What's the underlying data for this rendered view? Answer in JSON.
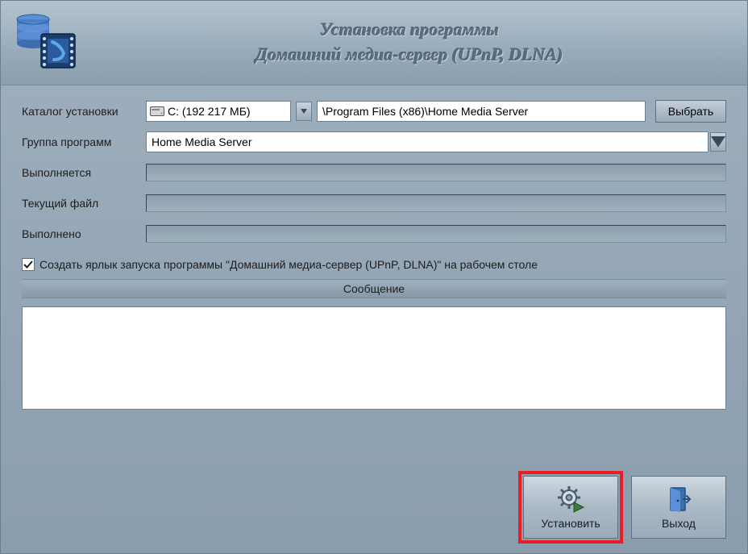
{
  "header": {
    "title_line1": "Установка программы",
    "title_line2": "Домашний медиа-сервер (UPnP, DLNA)"
  },
  "labels": {
    "install_dir": "Каталог установки",
    "program_group": "Группа программ",
    "in_progress": "Выполняется",
    "current_file": "Текущий файл",
    "completed": "Выполнено"
  },
  "drive": {
    "selected": "C: (192 217 МБ)"
  },
  "path": {
    "value": "\\Program Files (x86)\\Home Media Server"
  },
  "group": {
    "value": "Home Media Server"
  },
  "buttons": {
    "browse": "Выбрать",
    "install": "Установить",
    "exit": "Выход"
  },
  "checkbox": {
    "desktop_shortcut": "Создать ярлык запуска программы \"Домашний медиа-сервер (UPnP, DLNA)\" на рабочем столе",
    "checked": true
  },
  "message_header": "Сообщение"
}
